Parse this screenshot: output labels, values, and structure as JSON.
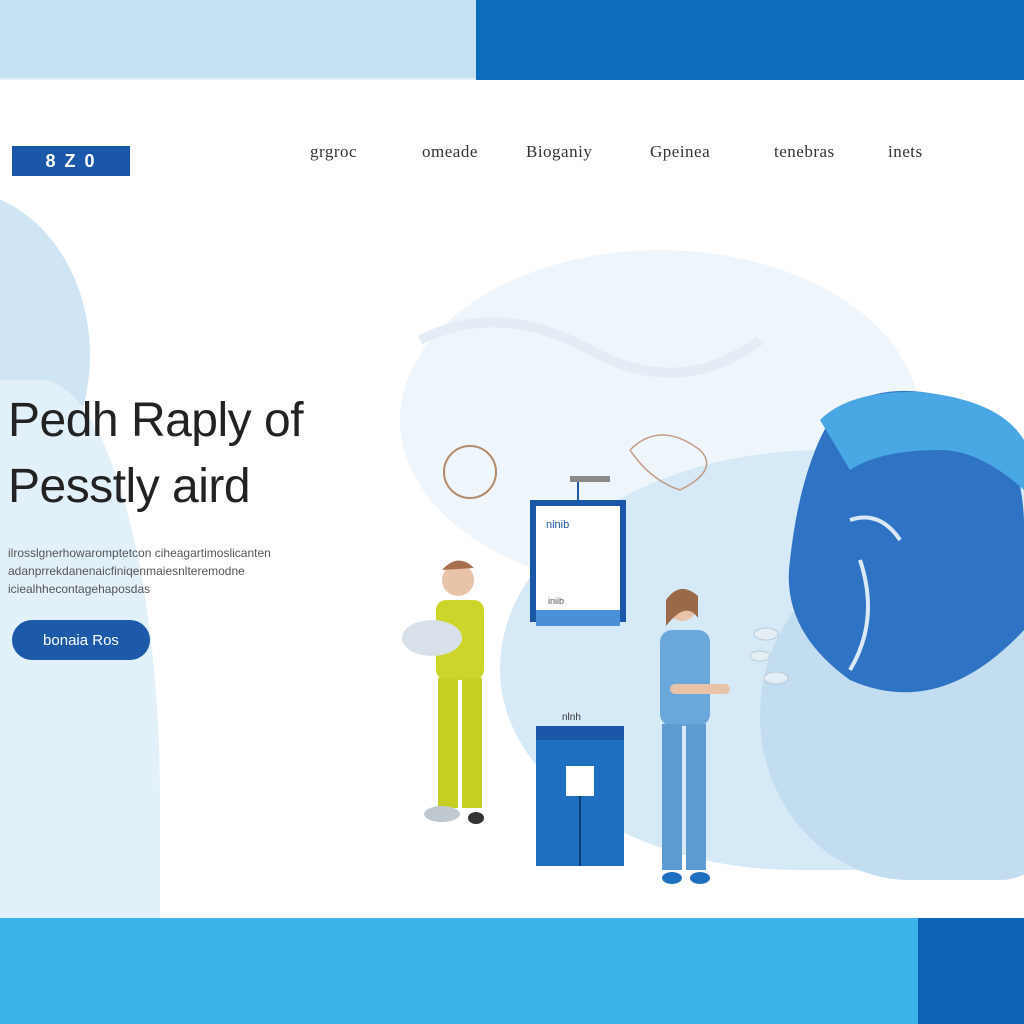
{
  "brand": {
    "logo_text": "8 Z 0"
  },
  "nav": {
    "items": [
      {
        "label": "grgroc"
      },
      {
        "label": "omeade"
      },
      {
        "label": "Bioganiy"
      },
      {
        "label": "Gpeinea"
      },
      {
        "label": "tenebras"
      },
      {
        "label": "inets"
      }
    ]
  },
  "hero": {
    "headline_line1": "Pedh Raply of",
    "headline_line2": "Pesstly aird",
    "description": "ilrosslgnerhowaromptetcon ciheagartimoslicanten adanprrekdanenaicfiniqenmaiesnlteremodne iciealhhecontagehaposdas",
    "cta_label": "bonaia  Ros"
  },
  "illustration": {
    "poster_title": "ninib",
    "poster_caption": "iniib",
    "device_label": "nlnh",
    "colors": {
      "primary": "#1b57a8",
      "accent_blue": "#4a90d9",
      "light_blue": "#cfe5f3",
      "worker_suit": "#cdd52a",
      "nurse_scrubs": "#6aa8dc",
      "face_profile": "#2f74c4",
      "hair_cap": "#49a7e3"
    }
  }
}
